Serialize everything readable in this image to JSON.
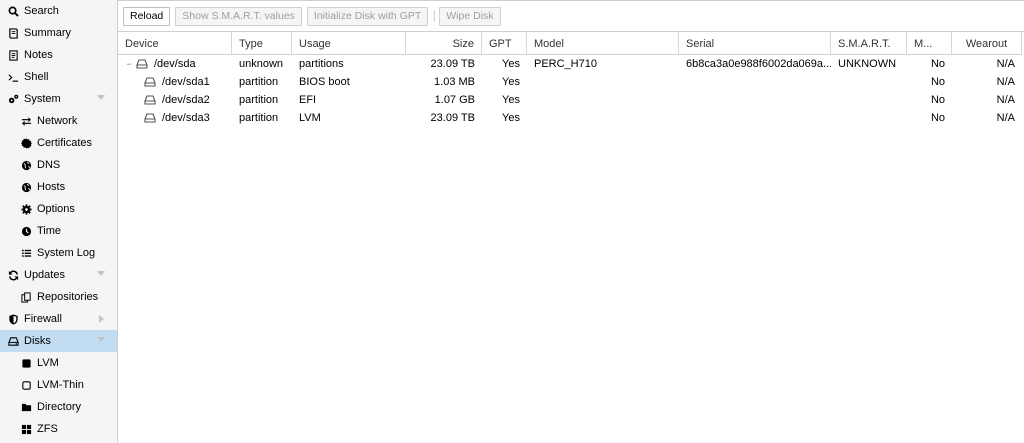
{
  "sidebar": {
    "items": [
      {
        "label": "Search",
        "icon": "search-icon"
      },
      {
        "label": "Summary",
        "icon": "book-icon"
      },
      {
        "label": "Notes",
        "icon": "note-icon"
      },
      {
        "label": "Shell",
        "icon": "terminal-icon"
      },
      {
        "label": "System",
        "icon": "gears-icon"
      },
      {
        "label": "Network",
        "icon": "exchange-icon"
      },
      {
        "label": "Certificates",
        "icon": "certificate-icon"
      },
      {
        "label": "DNS",
        "icon": "globe-icon"
      },
      {
        "label": "Hosts",
        "icon": "globe-icon"
      },
      {
        "label": "Options",
        "icon": "gear-icon"
      },
      {
        "label": "Time",
        "icon": "clock-icon"
      },
      {
        "label": "System Log",
        "icon": "list-icon"
      },
      {
        "label": "Updates",
        "icon": "refresh-icon"
      },
      {
        "label": "Repositories",
        "icon": "files-icon"
      },
      {
        "label": "Firewall",
        "icon": "shield-icon"
      },
      {
        "label": "Disks",
        "icon": "hdd-icon"
      },
      {
        "label": "LVM",
        "icon": "square-icon"
      },
      {
        "label": "LVM-Thin",
        "icon": "square-outline-icon"
      },
      {
        "label": "Directory",
        "icon": "folder-icon"
      },
      {
        "label": "ZFS",
        "icon": "grid-icon"
      }
    ]
  },
  "toolbar": {
    "reload": "Reload",
    "show_smart": "Show S.M.A.R.T. values",
    "init_gpt": "Initialize Disk with GPT",
    "wipe": "Wipe Disk"
  },
  "grid": {
    "columns": [
      "Device",
      "Type",
      "Usage",
      "Size",
      "GPT",
      "Model",
      "Serial",
      "S.M.A.R.T.",
      "M...",
      "Wearout"
    ],
    "rows": [
      {
        "device": "/dev/sda",
        "type": "unknown",
        "usage": "partitions",
        "size": "23.09 TB",
        "gpt": "Yes",
        "model": "PERC_H710",
        "serial": "6b8ca3a0e988f6002da069a...",
        "smart": "UNKNOWN",
        "mounted": "No",
        "wearout": "N/A"
      },
      {
        "device": "/dev/sda1",
        "type": "partition",
        "usage": "BIOS boot",
        "size": "1.03 MB",
        "gpt": "Yes",
        "model": "",
        "serial": "",
        "smart": "",
        "mounted": "No",
        "wearout": "N/A"
      },
      {
        "device": "/dev/sda2",
        "type": "partition",
        "usage": "EFI",
        "size": "1.07 GB",
        "gpt": "Yes",
        "model": "",
        "serial": "",
        "smart": "",
        "mounted": "No",
        "wearout": "N/A"
      },
      {
        "device": "/dev/sda3",
        "type": "partition",
        "usage": "LVM",
        "size": "23.09 TB",
        "gpt": "Yes",
        "model": "",
        "serial": "",
        "smart": "",
        "mounted": "No",
        "wearout": "N/A"
      }
    ]
  }
}
